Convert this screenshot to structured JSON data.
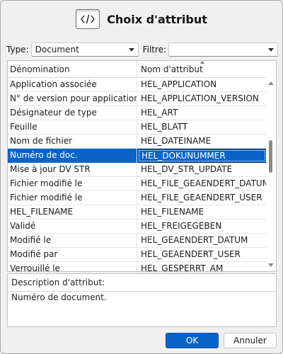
{
  "dialog": {
    "title": "Choix d'attribut",
    "icon": "code-brackets-icon"
  },
  "filters": {
    "type_label": "Type:",
    "type_value": "Document",
    "filter_label": "Filtre:",
    "filter_value": ""
  },
  "table": {
    "columns": [
      "Dénomination",
      "Nom d'attribut"
    ],
    "sort_column": "Nom d'attribut",
    "rows": [
      {
        "name": "Application associée",
        "attribute": "HEL_APPLICATION"
      },
      {
        "name": "N° de version pour application concernée",
        "attribute": "HEL_APPLICATION_VERSION"
      },
      {
        "name": "Désignateur de type",
        "attribute": "HEL_ART"
      },
      {
        "name": "Feuille",
        "attribute": "HEL_BLATT"
      },
      {
        "name": "Nom de fichier",
        "attribute": "HEL_DATEINAME"
      },
      {
        "name": "Numéro de doc.",
        "attribute": "HEL_DOKUNUMMER",
        "selected": true
      },
      {
        "name": "Mise à jour DV STR",
        "attribute": "HEL_DV_STR_UPDATE"
      },
      {
        "name": "Fichier modifié le",
        "attribute": "HEL_FILE_GEAENDERT_DATUM"
      },
      {
        "name": "Fichier modifié le",
        "attribute": "HEL_FILE_GEAENDERT_USER"
      },
      {
        "name": "HEL_FILENAME",
        "attribute": "HEL_FILENAME"
      },
      {
        "name": "Validé",
        "attribute": "HEL_FREIGEGEBEN"
      },
      {
        "name": "Modifié le",
        "attribute": "HEL_GEAENDERT_DATUM"
      },
      {
        "name": "Modifié par",
        "attribute": "HEL_GEAENDERT_USER"
      },
      {
        "name": "Verrouillé le",
        "attribute": "HEL_GESPERRT_AM"
      }
    ]
  },
  "description": {
    "label": "Description d'attribut:",
    "text": "Numéro de document."
  },
  "buttons": {
    "ok": "OK",
    "cancel": "Annuler"
  },
  "colors": {
    "accent": "#0a64c8",
    "background": "#f0f0f0"
  }
}
